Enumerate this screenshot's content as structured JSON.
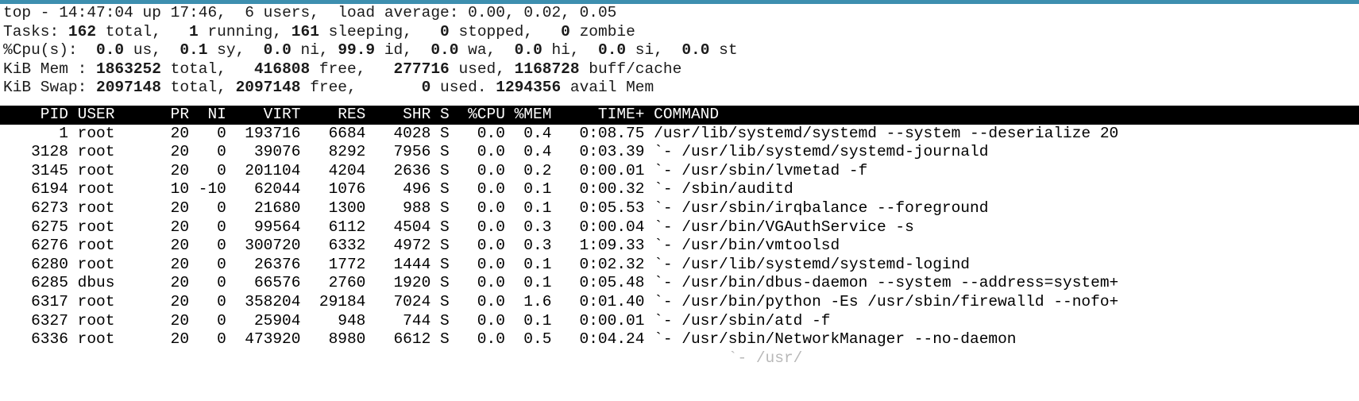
{
  "window": {
    "accent_color": "#3d8faf",
    "background_color": "#ffffff",
    "foreground_color": "#000000",
    "header_background_color": "#000000",
    "header_foreground_color": "#ffffff"
  },
  "summary": {
    "uptime_line": {
      "program": "top",
      "dash": " - ",
      "time": "14:47:04",
      "up_label": " up ",
      "uptime": "17:46,",
      "users_count": "  6",
      "users_label": " users,  ",
      "load_label": "load average: ",
      "load_1": "0.00",
      "load_5": "0.02",
      "load_15": "0.05",
      "full": "top - 14:47:04 up 17:46,  6 users,  load average: 0.00, 0.02, 0.05"
    },
    "tasks_line": {
      "label": "Tasks: ",
      "total": "162",
      "total_label": " total,  ",
      "running": " 1",
      "running_label": " running, ",
      "sleeping": "161",
      "sleeping_label": " sleeping,  ",
      "stopped": " 0",
      "stopped_label": " stopped,  ",
      "zombie": " 0",
      "zombie_label": " zombie",
      "full": "Tasks: 162 total,   1 running, 161 sleeping,   0 stopped,   0 zombie"
    },
    "cpu_line": {
      "label": "%Cpu(s): ",
      "us": " 0.0",
      "us_label": " us, ",
      "sy": " 0.1",
      "sy_label": " sy, ",
      "ni": " 0.0",
      "ni_label": " ni, ",
      "id": "99.9",
      "id_label": " id, ",
      "wa": " 0.0",
      "wa_label": " wa, ",
      "hi": " 0.0",
      "hi_label": " hi, ",
      "si": " 0.0",
      "si_label": " si, ",
      "st": " 0.0",
      "st_label": " st",
      "full": "%Cpu(s):  0.0 us,  0.1 sy,  0.0 ni, 99.9 id,  0.0 wa,  0.0 hi,  0.0 si,  0.0 st"
    },
    "mem_line": {
      "label": "KiB Mem : ",
      "total": "1863252",
      "total_label": " total, ",
      "free": "  416808",
      "free_label": " free, ",
      "used": "  277716",
      "used_label": " used, ",
      "buff_cache": "1168728",
      "buff_cache_label": " buff/cache",
      "full": "KiB Mem :  1863252 total,   416808 free,   277716 used,  1168728 buff/cache"
    },
    "swap_line": {
      "label": "KiB Swap: ",
      "total": "2097148",
      "total_label": " total, ",
      "free": "2097148",
      "free_label": " free, ",
      "used": "      0",
      "used_label": " used. ",
      "avail": "1294356",
      "avail_label": " avail Mem",
      "full": "KiB Swap:  2097148 total,  2097148 free,        0 used.  1294356 avail Mem"
    }
  },
  "table": {
    "columns": [
      "PID",
      "USER",
      "PR",
      "NI",
      "VIRT",
      "RES",
      "SHR",
      "S",
      "%CPU",
      "%MEM",
      "TIME+",
      "COMMAND"
    ],
    "header_text": "    PID USER      PR  NI    VIRT    RES    SHR S  %CPU %MEM     TIME+ COMMAND",
    "sort_field": "%CPU",
    "rows": [
      {
        "pid": "      1",
        "user": " root",
        "pr": "     20",
        "ni": "   0",
        "virt": "  193716",
        "res": "   6684",
        "shr": "   4028",
        "s": " S",
        "cpu": "   0.0",
        "mem": "  0.4",
        "time": "    0:08.75",
        "command": " /usr/lib/systemd/systemd --system --deserialize 20",
        "line": "      1 root      20   0  193716   6684   4028 S   0.0  0.4   0:08.75 /usr/lib/systemd/systemd --system --deserialize 20"
      },
      {
        "pid": "   3128",
        "user": " root",
        "pr": "     20",
        "ni": "   0",
        "virt": "   39076",
        "res": "   8292",
        "shr": "   7956",
        "s": " S",
        "cpu": "   0.0",
        "mem": "  0.4",
        "time": "    0:03.39",
        "command": " `- /usr/lib/systemd/systemd-journald",
        "line": "   3128 root      20   0   39076   8292   7956 S   0.0  0.4   0:03.39 `- /usr/lib/systemd/systemd-journald"
      },
      {
        "pid": "   3145",
        "user": " root",
        "pr": "     20",
        "ni": "   0",
        "virt": "  201104",
        "res": "   4204",
        "shr": "   2636",
        "s": " S",
        "cpu": "   0.0",
        "mem": "  0.2",
        "time": "    0:00.01",
        "command": " `- /usr/sbin/lvmetad -f",
        "line": "   3145 root      20   0  201104   4204   2636 S   0.0  0.2   0:00.01 `- /usr/sbin/lvmetad -f"
      },
      {
        "pid": "   6194",
        "user": " root",
        "pr": "     10",
        "ni": " -10",
        "virt": "   62044",
        "res": "   1076",
        "shr": "    496",
        "s": " S",
        "cpu": "   0.0",
        "mem": "  0.1",
        "time": "    0:00.32",
        "command": " `- /sbin/auditd",
        "line": "   6194 root      10 -10   62044   1076    496 S   0.0  0.1   0:00.32 `- /sbin/auditd"
      },
      {
        "pid": "   6273",
        "user": " root",
        "pr": "     20",
        "ni": "   0",
        "virt": "   21680",
        "res": "   1300",
        "shr": "    988",
        "s": " S",
        "cpu": "   0.0",
        "mem": "  0.1",
        "time": "    0:05.53",
        "command": " `- /usr/sbin/irqbalance --foreground",
        "line": "   6273 root      20   0   21680   1300    988 S   0.0  0.1   0:05.53 `- /usr/sbin/irqbalance --foreground"
      },
      {
        "pid": "   6275",
        "user": " root",
        "pr": "     20",
        "ni": "   0",
        "virt": "   99564",
        "res": "   6112",
        "shr": "   4504",
        "s": " S",
        "cpu": "   0.0",
        "mem": "  0.3",
        "time": "    0:00.04",
        "command": " `- /usr/bin/VGAuthService -s",
        "line": "   6275 root      20   0   99564   6112   4504 S   0.0  0.3   0:00.04 `- /usr/bin/VGAuthService -s"
      },
      {
        "pid": "   6276",
        "user": " root",
        "pr": "     20",
        "ni": "   0",
        "virt": "  300720",
        "res": "   6332",
        "shr": "   4972",
        "s": " S",
        "cpu": "   0.0",
        "mem": "  0.3",
        "time": "    1:09.33",
        "command": " `- /usr/bin/vmtoolsd",
        "line": "   6276 root      20   0  300720   6332   4972 S   0.0  0.3   1:09.33 `- /usr/bin/vmtoolsd"
      },
      {
        "pid": "   6280",
        "user": " root",
        "pr": "     20",
        "ni": "   0",
        "virt": "   26376",
        "res": "   1772",
        "shr": "   1444",
        "s": " S",
        "cpu": "   0.0",
        "mem": "  0.1",
        "time": "    0:02.32",
        "command": " `- /usr/lib/systemd/systemd-logind",
        "line": "   6280 root      20   0   26376   1772   1444 S   0.0  0.1   0:02.32 `- /usr/lib/systemd/systemd-logind"
      },
      {
        "pid": "   6285",
        "user": " dbus",
        "pr": "     20",
        "ni": "   0",
        "virt": "   66576",
        "res": "   2760",
        "shr": "   1920",
        "s": " S",
        "cpu": "   0.0",
        "mem": "  0.1",
        "time": "    0:05.48",
        "command": " `- /usr/bin/dbus-daemon --system --address=system+",
        "line": "   6285 dbus      20   0   66576   2760   1920 S   0.0  0.1   0:05.48 `- /usr/bin/dbus-daemon --system --address=system+"
      },
      {
        "pid": "   6317",
        "user": " root",
        "pr": "     20",
        "ni": "   0",
        "virt": "  358204",
        "res": "  29184",
        "shr": "   7024",
        "s": " S",
        "cpu": "   0.0",
        "mem": "  1.6",
        "time": "    0:01.40",
        "command": " `- /usr/bin/python -Es /usr/sbin/firewalld --nofo+",
        "line": "   6317 root      20   0  358204  29184   7024 S   0.0  1.6   0:01.40 `- /usr/bin/python -Es /usr/sbin/firewalld --nofo+"
      },
      {
        "pid": "   6327",
        "user": " root",
        "pr": "     20",
        "ni": "   0",
        "virt": "   25904",
        "res": "    948",
        "shr": "    744",
        "s": " S",
        "cpu": "   0.0",
        "mem": "  0.1",
        "time": "    0:00.01",
        "command": " `- /usr/sbin/atd -f",
        "line": "   6327 root      20   0   25904    948    744 S   0.0  0.1   0:00.01 `- /usr/sbin/atd -f"
      },
      {
        "pid": "   6336",
        "user": " root",
        "pr": "     20",
        "ni": "   0",
        "virt": "  473920",
        "res": "   8980",
        "shr": "   6612",
        "s": " S",
        "cpu": "   0.0",
        "mem": "  0.5",
        "time": "    0:04.24",
        "command": " `- /usr/sbin/NetworkManager --no-daemon",
        "line": "   6336 root      20   0  473920   8980   6612 S   0.0  0.5   0:04.24 `- /usr/sbin/NetworkManager --no-daemon"
      }
    ],
    "partial_row": {
      "line": "                                                                              `- /usr/"
    }
  }
}
